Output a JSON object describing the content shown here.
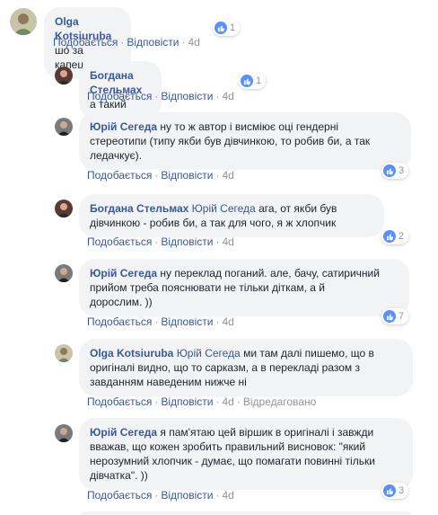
{
  "actions": {
    "like": "Подобається",
    "reply": "Відповісти",
    "separator": "·",
    "edited": "Відредаговано"
  },
  "comments": [
    {
      "author": "Olga Kotsiuruba",
      "mention": "",
      "text": "шо за капец",
      "age": "4d",
      "reactions": "1"
    },
    {
      "author": "Богдана Стельмах",
      "mention": "",
      "text": "а такий",
      "age": "4d",
      "reactions": "1"
    },
    {
      "author": "Юрій Сегеда",
      "mention": "",
      "text_lines": [
        "ну то ж автор і висміює оці гендерні",
        "стереотипи (типу якби був дівчинкою, то робив би, а так",
        "ледачкує)."
      ],
      "age": "4d",
      "reactions": "3"
    },
    {
      "author": "Богдана Стельмах",
      "mention": "Юрій Сегеда",
      "text_lines": [
        "ага, от якби був",
        "дівчинкою - робив би, а так для чого, я ж хлопчик"
      ],
      "age": "4d",
      "reactions": "2"
    },
    {
      "author": "Юрій Сегеда",
      "mention": "",
      "text_lines": [
        "ну переклад поганий. але, бачу, сатиричний",
        "прийом треба пояснювати не тільки діткам, а й",
        "дорослим. ))"
      ],
      "age": "4d",
      "reactions": "7"
    },
    {
      "author": "Olga Kotsiuruba",
      "mention": "Юрій Сегеда",
      "text_lines": [
        "ми там далі пишемо, що в",
        "оригіналі видно, що то сарказм, а в перекладі разом з",
        "завданням наведеним нижче ні"
      ],
      "age": "4d",
      "reactions": ""
    },
    {
      "author": "Юрій Сегеда",
      "mention": "",
      "text_lines": [
        "я пам'ятаю цей віршик в оригіналі і завжди",
        "вважав, що кожен зробить правильний висновок: \"який",
        "нерозумний хлопчик - думає, що помагати повинні тільки",
        "дівчатка\". ))"
      ],
      "age": "4d",
      "reactions": "3"
    }
  ]
}
